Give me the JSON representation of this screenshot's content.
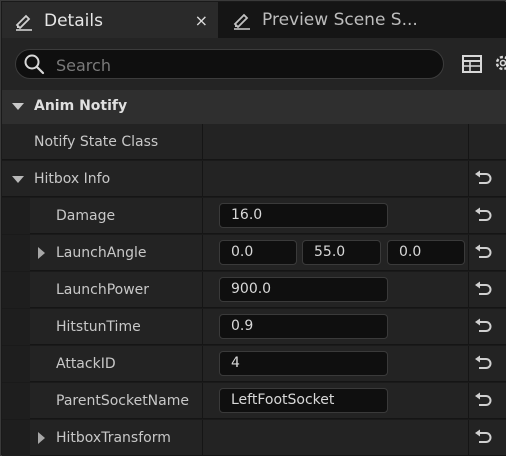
{
  "tabs": [
    {
      "label": "Details",
      "icon": "pencil-icon",
      "close": "×"
    },
    {
      "label": "Preview Scene S...",
      "icon": "pencil-icon"
    }
  ],
  "search": {
    "placeholder": "Search",
    "value": ""
  },
  "category": {
    "label": "Anim Notify"
  },
  "properties": {
    "notify_state_class": {
      "label": "Notify State Class"
    },
    "hitbox_info": {
      "label": "Hitbox Info"
    },
    "damage": {
      "label": "Damage",
      "value": "16.0"
    },
    "launch_angle": {
      "label": "LaunchAngle",
      "values": [
        "0.0",
        "55.0",
        "0.0"
      ]
    },
    "launch_power": {
      "label": "LaunchPower",
      "value": "900.0"
    },
    "hitstun_time": {
      "label": "HitstunTime",
      "value": "0.9"
    },
    "attack_id": {
      "label": "AttackID",
      "value": "4"
    },
    "parent_socket_name": {
      "label": "ParentSocketName",
      "value": "LeftFootSocket"
    },
    "hitbox_transform": {
      "label": "HitboxTransform"
    }
  },
  "colors": {
    "panel": "#232323",
    "background": "#1a1a1a",
    "field": "#0f0f0f",
    "text": "#c8c8c8"
  }
}
